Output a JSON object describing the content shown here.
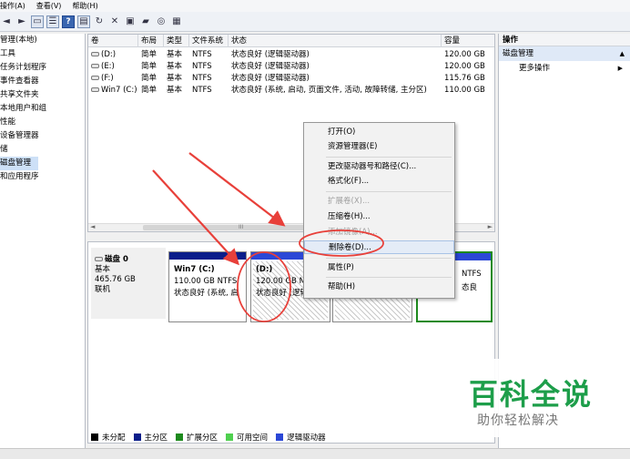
{
  "menu": {
    "items": [
      "操作(A)",
      "查看(V)",
      "帮助(H)"
    ]
  },
  "toolbar": {
    "icons": [
      "back-arrow-icon",
      "forward-arrow-icon",
      "console-tree-icon",
      "help-icon",
      "list-view-icon",
      "refresh-icon",
      "delete-icon",
      "properties-icon",
      "open-folder-icon",
      "magnify-icon",
      "export-icon"
    ]
  },
  "tree": {
    "items": [
      "管理(本地)",
      "工具",
      "任务计划程序",
      "事件查看器",
      "共享文件夹",
      "本地用户和组",
      "性能",
      "设备管理器",
      "储",
      "磁盘管理",
      "和应用程序"
    ],
    "selected": "磁盘管理"
  },
  "volume_list": {
    "columns": [
      "卷",
      "布局",
      "类型",
      "文件系统",
      "状态",
      "容量"
    ],
    "rows": [
      {
        "volume": "(D:)",
        "layout": "简单",
        "type": "基本",
        "fs": "NTFS",
        "status": "状态良好 (逻辑驱动器)",
        "capacity": "120.00 GB"
      },
      {
        "volume": "(E:)",
        "layout": "简单",
        "type": "基本",
        "fs": "NTFS",
        "status": "状态良好 (逻辑驱动器)",
        "capacity": "120.00 GB"
      },
      {
        "volume": "(F:)",
        "layout": "简单",
        "type": "基本",
        "fs": "NTFS",
        "status": "状态良好 (逻辑驱动器)",
        "capacity": "115.76 GB"
      },
      {
        "volume": "Win7 (C:)",
        "layout": "简单",
        "type": "基本",
        "fs": "NTFS",
        "status": "状态良好 (系统, 启动, 页面文件, 活动, 故障转储, 主分区)",
        "capacity": "110.00 GB"
      }
    ],
    "scroll_marker": "III"
  },
  "disk": {
    "name": "磁盘 0",
    "type": "基本",
    "size": "465.76 GB",
    "status": "联机"
  },
  "partitions": {
    "c": {
      "title": "Win7 (C:)",
      "size": "110.00 GB NTFS",
      "status": "状态良好 (系统, 启"
    },
    "d": {
      "title": "(D:)",
      "size": "120.00 GB N",
      "status": "状态良好 (逻辑"
    },
    "e": {
      "size": "NTFS",
      "status": "态良"
    }
  },
  "context_menu": {
    "open": "打开(O)",
    "explorer": "资源管理器(E)",
    "change_letter": "更改驱动器号和路径(C)...",
    "format": "格式化(F)...",
    "extend": "扩展卷(X)...",
    "shrink": "压缩卷(H)...",
    "add_mirror": "添加镜像(A)...",
    "delete": "删除卷(D)...",
    "properties": "属性(P)",
    "help": "帮助(H)"
  },
  "actions": {
    "header": "操作",
    "section": "磁盘管理",
    "more": "更多操作"
  },
  "legend": {
    "items": [
      {
        "label": "未分配",
        "color": "#000000"
      },
      {
        "label": "主分区",
        "color": "#0a1d8a"
      },
      {
        "label": "扩展分区",
        "color": "#1d8a1d"
      },
      {
        "label": "可用空间",
        "color": "#4fd04f"
      },
      {
        "label": "逻辑驱动器",
        "color": "#2b47d6"
      }
    ]
  },
  "watermark": {
    "title": "百科全说",
    "subtitle": "助你轻松解决"
  },
  "colors": {
    "annotation_red": "#e8403a",
    "primary_partition": "#0a1d8a",
    "logical_drive": "#2b47d6",
    "extended_partition": "#1d8a1d",
    "watermark_green": "#1d9e4a"
  }
}
